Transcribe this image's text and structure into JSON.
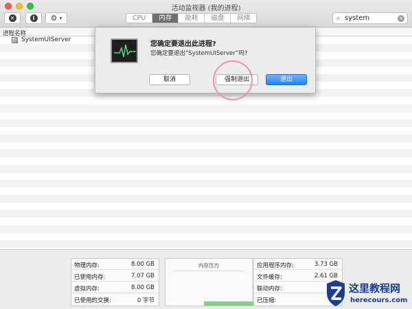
{
  "window": {
    "title": "活动监视器 (我的进程)"
  },
  "toolbar": {
    "stop_icon": "x-circle-icon",
    "info_icon": "info-icon",
    "gear_icon": "gear-icon",
    "tabs": [
      {
        "label": "CPU",
        "active": false
      },
      {
        "label": "内存",
        "active": true
      },
      {
        "label": "能耗",
        "active": false
      },
      {
        "label": "磁盘",
        "active": false
      },
      {
        "label": "网络",
        "active": false
      }
    ],
    "search_value": "system"
  },
  "table": {
    "column_header": "进程名称",
    "rows": [
      {
        "name": "SystemUIServer"
      }
    ]
  },
  "dialog": {
    "title": "您确定要退出此进程?",
    "message": "您确定要退出“SystemUIServer”吗?",
    "cancel_label": "取消",
    "force_quit_label": "强制退出",
    "quit_label": "退出"
  },
  "memory": {
    "left": [
      {
        "label": "物理内存:",
        "value": "8.00 GB"
      },
      {
        "label": "已使用内存:",
        "value": "7.07 GB"
      },
      {
        "label": "虚拟内存:",
        "value": "8.00 GB"
      },
      {
        "label": "已使用的交换:",
        "value": "0 字节"
      }
    ],
    "pressure_title": "内存压力",
    "right": [
      {
        "label": "应用程序内存:",
        "value": "3.73 GB"
      },
      {
        "label": "文件缓存:",
        "value": "2.61 GB"
      },
      {
        "label": "联动内存:",
        "value": ""
      },
      {
        "label": "已压缩:",
        "value": ""
      }
    ]
  },
  "watermark": {
    "line1": "这里教程网",
    "line2": "herecours.com"
  },
  "colors": {
    "accent_blue": "#1f84f6",
    "pressure_green": "#7ed27e",
    "highlight_pink": "#f08fae"
  }
}
